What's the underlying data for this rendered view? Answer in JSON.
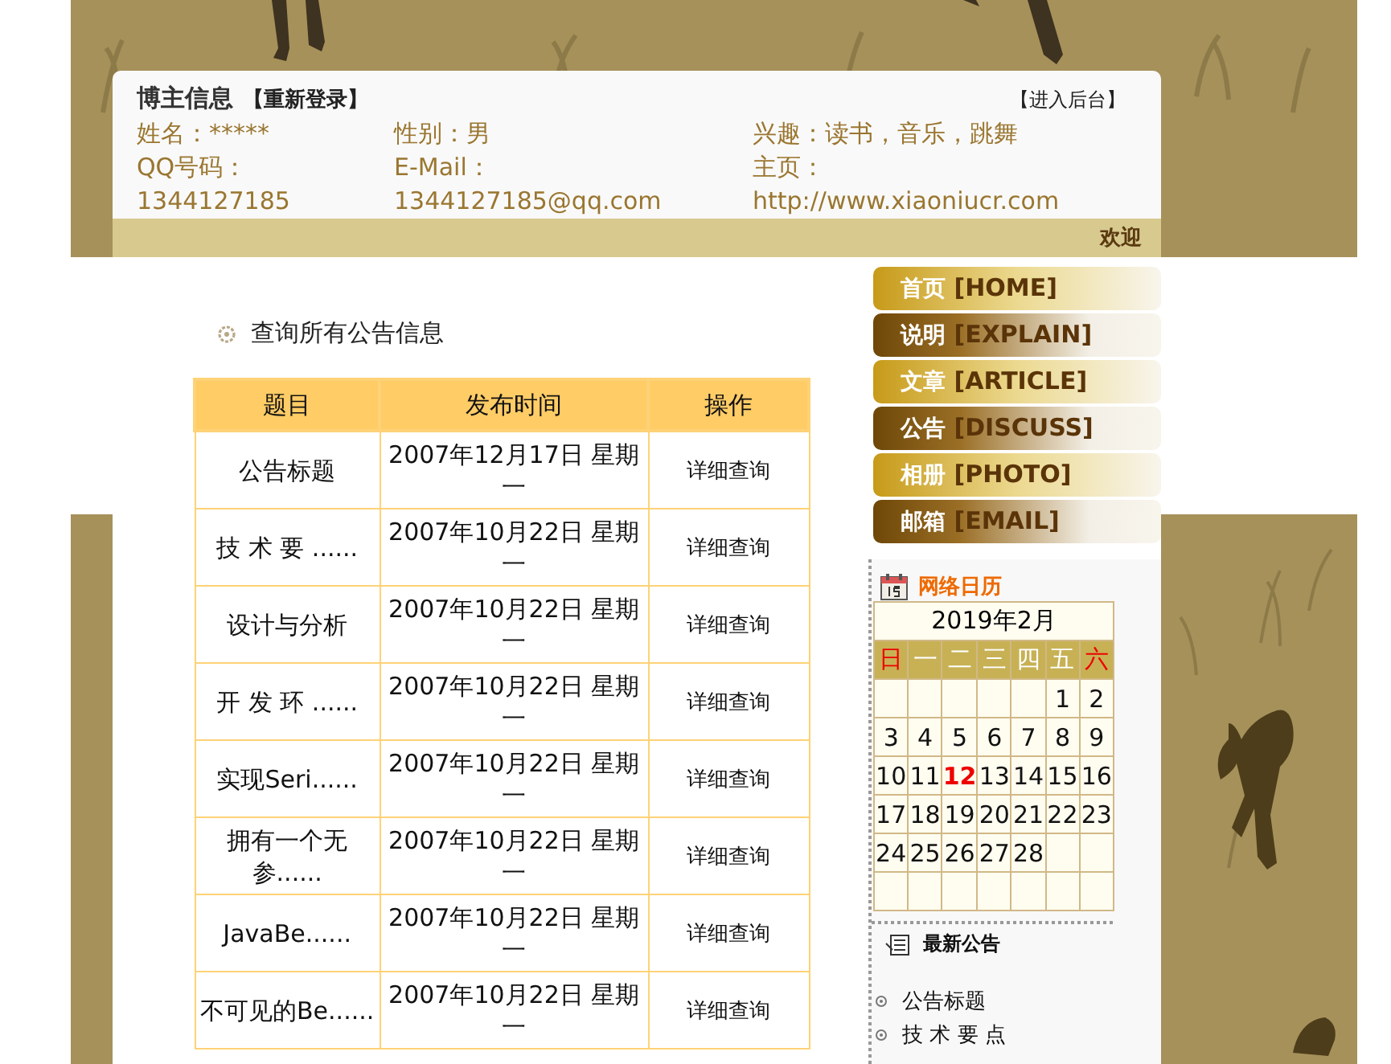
{
  "header": {
    "title": "博主信息",
    "relogin": "【重新登录】",
    "admin": "【进入后台】",
    "columns": [
      [
        "姓名：*****",
        "QQ号码：",
        "1344127185"
      ],
      [
        "性别：男",
        "E-Mail：",
        "1344127185@qq.com"
      ],
      [
        "兴趣：读书，音乐，跳舞",
        "主页：",
        "http://www.xiaoniucr.com"
      ]
    ],
    "welcome": "欢迎"
  },
  "section_title": "查询所有公告信息",
  "table": {
    "columns": [
      "题目",
      "发布时间",
      "操作"
    ],
    "rows": [
      {
        "title": "公告标题",
        "date": "2007年12月17日 星期一",
        "action": "详细查询"
      },
      {
        "title": "技 术 要 ......",
        "date": "2007年10月22日 星期一",
        "action": "详细查询"
      },
      {
        "title": "设计与分析",
        "date": "2007年10月22日 星期一",
        "action": "详细查询"
      },
      {
        "title": "开 发 环 ......",
        "date": "2007年10月22日 星期一",
        "action": "详细查询"
      },
      {
        "title": "实现Seri......",
        "date": "2007年10月22日 星期一",
        "action": "详细查询"
      },
      {
        "title": "拥有一个无参......",
        "date": "2007年10月22日 星期一",
        "action": "详细查询"
      },
      {
        "title": "JavaBe......",
        "date": "2007年10月22日 星期一",
        "action": "详细查询"
      },
      {
        "title": "不可见的Be......",
        "date": "2007年10月22日 星期一",
        "action": "详细查询"
      }
    ]
  },
  "nav": [
    {
      "label": "首页",
      "en": "[HOME]"
    },
    {
      "label": "说明",
      "en": "[EXPLAIN]"
    },
    {
      "label": "文章",
      "en": "[ARTICLE]"
    },
    {
      "label": "公告",
      "en": "[DISCUSS]"
    },
    {
      "label": "相册",
      "en": "[PHOTO]"
    },
    {
      "label": "邮箱",
      "en": "[EMAIL]"
    }
  ],
  "calendar": {
    "title": "网络日历",
    "month": "2019年2月",
    "weekdays": [
      {
        "label": "日",
        "weekend": true
      },
      {
        "label": "一",
        "weekend": false
      },
      {
        "label": "二",
        "weekend": false
      },
      {
        "label": "三",
        "weekend": false
      },
      {
        "label": "四",
        "weekend": false
      },
      {
        "label": "五",
        "weekend": false
      },
      {
        "label": "六",
        "weekend": true
      }
    ],
    "weeks": [
      [
        {
          "kind": "blank"
        },
        {
          "kind": "blank"
        },
        {
          "kind": "blank"
        },
        {
          "kind": "blank"
        },
        {
          "kind": "blank"
        },
        {
          "day": "1",
          "today": false
        },
        {
          "day": "2",
          "today": false
        }
      ],
      [
        {
          "day": "3",
          "today": false
        },
        {
          "day": "4",
          "today": false
        },
        {
          "day": "5",
          "today": false
        },
        {
          "day": "6",
          "today": false
        },
        {
          "day": "7",
          "today": false
        },
        {
          "day": "8",
          "today": false
        },
        {
          "day": "9",
          "today": false
        }
      ],
      [
        {
          "day": "10",
          "today": false
        },
        {
          "day": "11",
          "today": false
        },
        {
          "day": "12",
          "today": true
        },
        {
          "day": "13",
          "today": false
        },
        {
          "day": "14",
          "today": false
        },
        {
          "day": "15",
          "today": false
        },
        {
          "day": "16",
          "today": false
        }
      ],
      [
        {
          "day": "17",
          "today": false
        },
        {
          "day": "18",
          "today": false
        },
        {
          "day": "19",
          "today": false
        },
        {
          "day": "20",
          "today": false
        },
        {
          "day": "21",
          "today": false
        },
        {
          "day": "22",
          "today": false
        },
        {
          "day": "23",
          "today": false
        }
      ],
      [
        {
          "day": "24",
          "today": false
        },
        {
          "day": "25",
          "today": false
        },
        {
          "day": "26",
          "today": false
        },
        {
          "day": "27",
          "today": false
        },
        {
          "day": "28",
          "today": false
        },
        {
          "kind": "blank"
        },
        {
          "kind": "blank"
        }
      ],
      [
        {
          "kind": "blank"
        },
        {
          "kind": "blank"
        },
        {
          "kind": "blank"
        },
        {
          "kind": "blank"
        },
        {
          "kind": "blank"
        },
        {
          "kind": "blank"
        },
        {
          "kind": "blank"
        }
      ]
    ]
  },
  "notices": {
    "title": "最新公告",
    "items": [
      "公告标题",
      "技 术 要 点"
    ]
  }
}
